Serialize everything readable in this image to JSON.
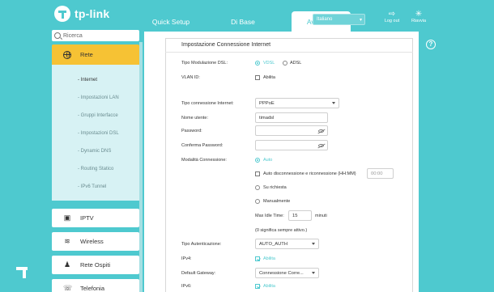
{
  "header": {
    "brand": "tp-link",
    "tabs": [
      "Quick Setup",
      "Di Base",
      "Avanzate"
    ],
    "language": "Italiano",
    "logout_label": "Log out",
    "reboot_label": "Riavvia"
  },
  "sidebar": {
    "search_placeholder": "Ricerca",
    "active_section": "Rete",
    "subitems": [
      "- Internet",
      "- Impostazioni LAN",
      "- Gruppi Interfacce",
      "- Impostazioni DSL",
      "- Dynamic DNS",
      "- Routing Statico",
      "- IPv6 Tunnel"
    ],
    "items": [
      "IPTV",
      "Wireless",
      "Rete Ospiti",
      "Telefonia"
    ]
  },
  "form": {
    "title": "Impostazione Connessione Internet",
    "dsl_mode_label": "Tipo Modulazione DSL:",
    "dsl_options": [
      "VDSL",
      "ADSL"
    ],
    "vlan_label": "VLAN ID:",
    "vlan_enable": "Abilita",
    "conn_type_label": "Tipo connessione Internet:",
    "conn_type_value": "PPPoE",
    "username_label": "Nome utente:",
    "username_value": "timadsl",
    "password_label": "Password:",
    "confirm_password_label": "Conferma Password:",
    "conn_mode_label": "Modalità Connessione:",
    "mode_auto": "Auto",
    "auto_disconnect_label": "Auto disconnessione e riconnessione (HH:MM)",
    "auto_disconnect_time": "00:00",
    "mode_on_demand": "Su richiesta",
    "mode_manual": "Manualmente",
    "max_idle_label": "Max Idle Time:",
    "max_idle_value": "15",
    "max_idle_unit": "minuti",
    "always_active_note": "(0 significa sempre attivo.)",
    "auth_type_label": "Tipo Autenticazione:",
    "auth_type_value": "AUTO_AUTH",
    "ipv4_label": "IPv4:",
    "ipv4_enable": "Abilita",
    "gateway_label": "Default Gateway:",
    "gateway_value": "Connessione Corre...",
    "ipv6_label": "IPv6:",
    "ipv6_enable": "Abilita"
  },
  "colors": {
    "accent": "#4ec9cf",
    "active_menu": "#f6c234",
    "submenu_bg": "#d7f2f4"
  }
}
